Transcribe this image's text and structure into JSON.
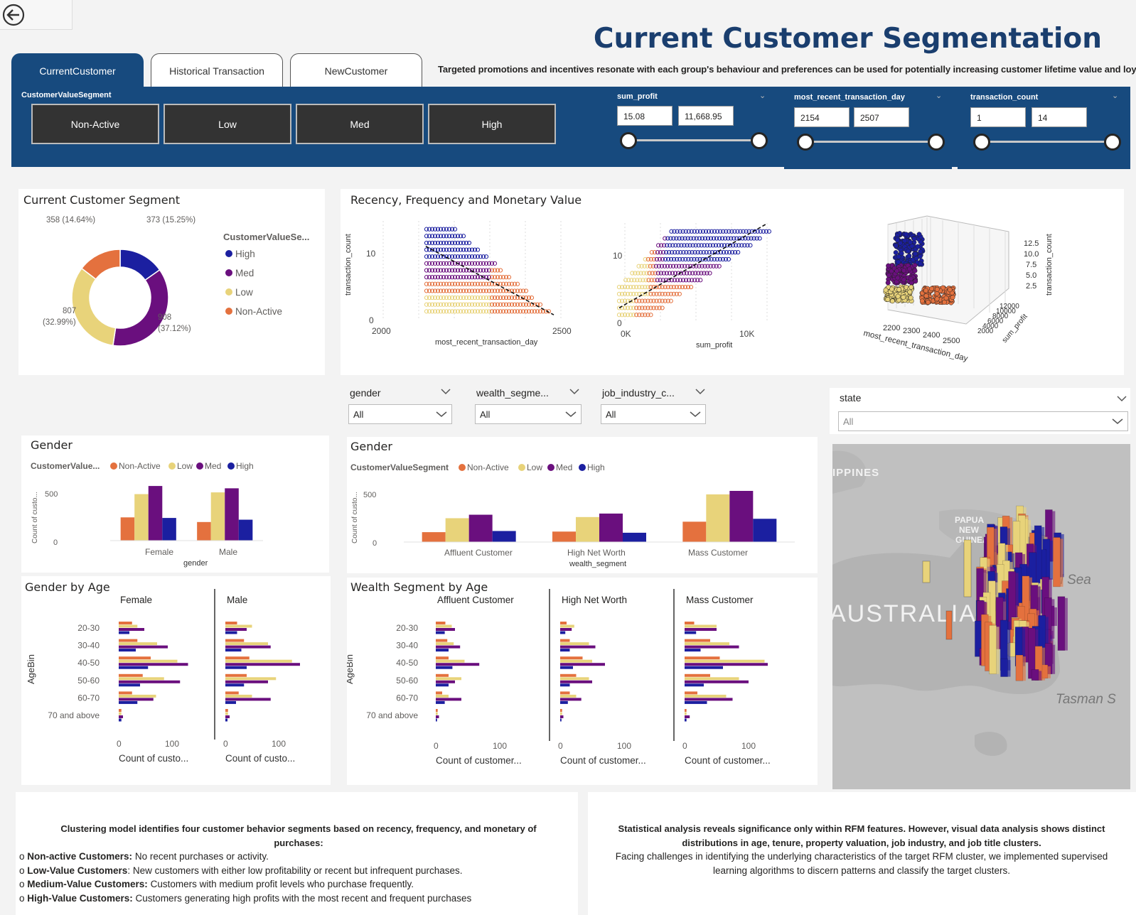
{
  "header": {
    "title": "Current Customer Segmentation",
    "subtitle": "Targeted promotions and incentives resonate with each group's behaviour and preferences can be used for potentially increasing customer lifetime value and loyalty"
  },
  "tabs": [
    {
      "label": "CurrentCustomer"
    },
    {
      "label": "Historical Transaction"
    },
    {
      "label": "NewCustomer"
    }
  ],
  "filters": {
    "segment_label": "CustomerValueSegment",
    "segments": [
      "Non-Active",
      "Low",
      "Med",
      "High"
    ],
    "sum_profit": {
      "label": "sum_profit",
      "min": "15.08",
      "max": "11,668.95"
    },
    "recent_day": {
      "label": "most_recent_transaction_day",
      "min": "2154",
      "max": "2507"
    },
    "tx_count": {
      "label": "transaction_count",
      "min": "1",
      "max": "14"
    }
  },
  "colors": {
    "High": "#1b1fa0",
    "Med": "#6a0f7e",
    "Low": "#e8d37a",
    "NonActive": "#e4713e",
    "band": "#174A7E"
  },
  "donut": {
    "title": "Current Customer Segment",
    "legend_title": "CustomerValueSe...",
    "legend": [
      "High",
      "Med",
      "Low",
      "Non-Active"
    ],
    "labels": {
      "high": "373 (15.25%)",
      "med1": "908",
      "med2": "(37.12%)",
      "low1": "807",
      "low2": "(32.99%)",
      "na": "358 (14.64%)"
    }
  },
  "chart_data": [
    {
      "type": "pie",
      "title": "Current Customer Segment",
      "categories": [
        "High",
        "Med",
        "Low",
        "Non-Active"
      ],
      "values": [
        373,
        908,
        807,
        358
      ],
      "percent": [
        15.25,
        37.12,
        32.99,
        14.64
      ]
    },
    {
      "type": "bar",
      "title": "Gender",
      "categories": [
        "Female",
        "Male"
      ],
      "xlabel": "gender",
      "ylabel": "Count of custo...",
      "ylim": [
        0,
        550
      ],
      "series": [
        {
          "name": "Non-Active",
          "values": [
            200,
            160
          ]
        },
        {
          "name": "Low",
          "values": [
            400,
            415
          ]
        },
        {
          "name": "Med",
          "values": [
            470,
            450
          ]
        },
        {
          "name": "High",
          "values": [
            195,
            180
          ]
        }
      ]
    },
    {
      "type": "bar",
      "title": "Gender",
      "categories": [
        "Affluent Customer",
        "High Net Worth",
        "Mass Customer"
      ],
      "xlabel": "wealth_segment",
      "ylabel": "Count of custo...",
      "ylim": [
        0,
        550
      ],
      "series": [
        {
          "name": "Non-Active",
          "values": [
            85,
            90,
            175
          ]
        },
        {
          "name": "Low",
          "values": [
            205,
            215,
            410
          ]
        },
        {
          "name": "Med",
          "values": [
            235,
            245,
            440
          ]
        },
        {
          "name": "High",
          "values": [
            95,
            80,
            200
          ]
        }
      ]
    },
    {
      "type": "bar",
      "title": "Gender by Age",
      "categories": [
        "20-30",
        "30-40",
        "40-50",
        "50-60",
        "60-70",
        "70 and above"
      ],
      "panels": [
        "Female",
        "Male"
      ],
      "xlabel": "Count of custo...",
      "ylabel": "AgeBin",
      "panel_data": [
        {
          "name": "Female",
          "series": [
            {
              "name": "Non-Active",
              "values": [
                25,
                35,
                60,
                45,
                25,
                5
              ]
            },
            {
              "name": "Low",
              "values": [
                35,
                72,
                110,
                85,
                70,
                5
              ]
            },
            {
              "name": "Med",
              "values": [
                48,
                92,
                130,
                115,
                65,
                8
              ]
            },
            {
              "name": "High",
              "values": [
                20,
                32,
                55,
                40,
                35,
                5
              ]
            }
          ]
        },
        {
          "name": "Male",
          "series": [
            {
              "name": "Non-Active",
              "values": [
                22,
                35,
                45,
                40,
                25,
                5
              ]
            },
            {
              "name": "Low",
              "values": [
                50,
                80,
                125,
                95,
                50,
                5
              ]
            },
            {
              "name": "Med",
              "values": [
                40,
                85,
                140,
                80,
                85,
                8
              ]
            },
            {
              "name": "High",
              "values": [
                22,
                30,
                40,
                35,
                20,
                4
              ]
            }
          ]
        }
      ]
    },
    {
      "type": "bar",
      "title": "Wealth Segment by Age",
      "categories": [
        "20-30",
        "30-40",
        "40-50",
        "50-60",
        "60-70",
        "70 and above"
      ],
      "panels": [
        "Affluent Customer",
        "High Net Worth",
        "Mass Customer"
      ],
      "xlabel": "Count of customer...",
      "ylabel": "AgeBin",
      "panel_data": [
        {
          "name": "Affluent Customer",
          "series": [
            {
              "name": "Non-Active",
              "values": [
                15,
                18,
                20,
                20,
                10,
                3
              ]
            },
            {
              "name": "Low",
              "values": [
                25,
                28,
                45,
                40,
                20,
                3
              ]
            },
            {
              "name": "Med",
              "values": [
                30,
                38,
                68,
                30,
                40,
                5
              ]
            },
            {
              "name": "High",
              "values": [
                14,
                20,
                26,
                20,
                14,
                2
              ]
            }
          ]
        },
        {
          "name": "High Net Worth",
          "series": [
            {
              "name": "Non-Active",
              "values": [
                10,
                15,
                35,
                25,
                15,
                3
              ]
            },
            {
              "name": "Low",
              "values": [
                22,
                45,
                50,
                45,
                25,
                3
              ]
            },
            {
              "name": "Med",
              "values": [
                18,
                55,
                70,
                50,
                33,
                5
              ]
            },
            {
              "name": "High",
              "values": [
                8,
                15,
                20,
                15,
                12,
                2
              ]
            }
          ]
        },
        {
          "name": "Mass Customer",
          "series": [
            {
              "name": "Non-Active",
              "values": [
                15,
                40,
                55,
                40,
                20,
                3
              ]
            },
            {
              "name": "Low",
              "values": [
                50,
                70,
                125,
                85,
                65,
                3
              ]
            },
            {
              "name": "Med",
              "values": [
                50,
                85,
                130,
                100,
                75,
                8
              ]
            },
            {
              "name": "High",
              "values": [
                18,
                25,
                60,
                30,
                35,
                3
              ]
            }
          ]
        }
      ]
    }
  ],
  "rfm": {
    "title": "Recency, Frequency and Monetary Value",
    "p1": {
      "ylabel": "transaction_count",
      "xlabel": "most_recent_transaction_day",
      "x0": "2000",
      "x1": "2500",
      "y0": "0",
      "y1": "10"
    },
    "p2": {
      "xlabel": "sum_profit",
      "x0": "0K",
      "x1": "10K",
      "y0": "0",
      "y1": "10"
    },
    "p3": {
      "xlabel": "most_recent_transaction_day",
      "ylabel": "transaction_count",
      "ylabel2": "sum_profit",
      "zticks": [
        "12.5",
        "10.0",
        "7.5",
        "5.0",
        "2.5"
      ],
      "xticks": [
        "2200",
        "2300",
        "2400",
        "2500"
      ],
      "yticks": [
        "12000",
        "10000",
        "8000",
        "6000",
        "4000",
        "2000"
      ]
    }
  },
  "slicers": {
    "gender": {
      "label": "gender",
      "value": "All"
    },
    "wealth": {
      "label": "wealth_segme...",
      "value": "All"
    },
    "job": {
      "label": "job_industry_c...",
      "value": "All"
    },
    "state": {
      "label": "state",
      "value": "All"
    }
  },
  "bar_gender": {
    "title": "Gender",
    "legend_title": "CustomerValue...",
    "legend": [
      "Non-Active",
      "Low",
      "Med",
      "High"
    ],
    "ylabel": "Count of custo...",
    "xlabel": "gender",
    "cats": [
      "Female",
      "Male"
    ],
    "y500": "500",
    "y0": "0"
  },
  "bar_wealth": {
    "title": "Gender",
    "legend_title": "CustomerValueSegment",
    "legend": [
      "Non-Active",
      "Low",
      "Med",
      "High"
    ],
    "ylabel": "Count of custo...",
    "xlabel": "wealth_segment",
    "cats": [
      "Affluent Customer",
      "High Net Worth",
      "Mass Customer"
    ],
    "y500": "500",
    "y0": "0"
  },
  "age_gender": {
    "title": "Gender by Age",
    "panels": [
      "Female",
      "Male"
    ],
    "ylabel": "AgeBin",
    "bins": [
      "20-30",
      "30-40",
      "40-50",
      "50-60",
      "60-70",
      "70 and above"
    ],
    "xlabel": "Count of custo...",
    "ticks": [
      "0",
      "100"
    ]
  },
  "age_wealth": {
    "title": "Wealth Segment by Age",
    "panels": [
      "Affluent Customer",
      "High Net Worth",
      "Mass Customer"
    ],
    "ylabel": "AgeBin",
    "bins": [
      "20-30",
      "30-40",
      "40-50",
      "50-60",
      "60-70",
      "70 and above"
    ],
    "xlabel": "Count of customer...",
    "ticks": [
      "0",
      "100"
    ]
  },
  "map": {
    "labels": [
      "IPPINES",
      "PAPUA",
      "NEW",
      "GUINEA",
      "AUSTRALIA",
      "al Sea",
      "Tasman S"
    ]
  },
  "notes": {
    "left_title": "Clustering model identifies four customer behavior segments based on recency, frequency, and monetary of purchases:",
    "left_items": [
      {
        "bold": "Non-active Customers:",
        "text": " No recent purchases or activity."
      },
      {
        "bold": "Low-Value Customers",
        "text": ": New customers with either low profitability or recent but infrequent purchases."
      },
      {
        "bold": "Medium-Value Customers:",
        "text": " Customers with medium profit levels who purchase frequently."
      },
      {
        "bold": "High-Value Customers:",
        "text": " Customers generating high profits with the most recent and frequent purchases"
      }
    ],
    "right_title": "Statistical analysis reveals significance only within RFM features. However, visual data analysis shows distinct distributions in age, tenure, property valuation, job industry, and job title  clusters.",
    "right_text": "Facing challenges in identifying the underlying characteristics of the target RFM cluster, we implemented supervised learning algorithms to discern patterns and classify the target clusters."
  }
}
